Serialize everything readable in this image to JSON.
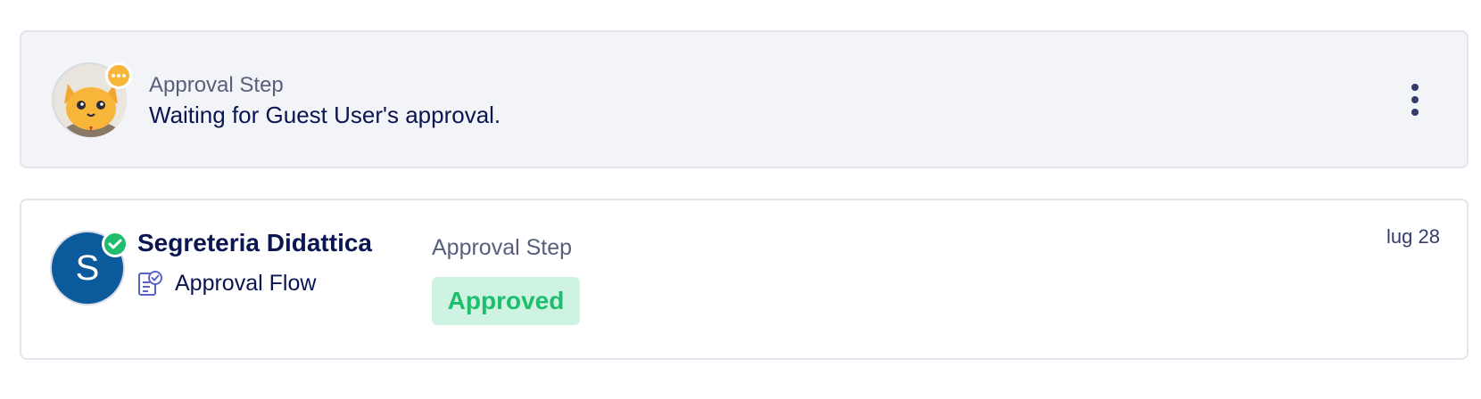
{
  "pending_step": {
    "step_label": "Approval Step",
    "message": "Waiting for Guest User's approval.",
    "avatar_icon": "cat-avatar-icon",
    "status_icon": "ellipsis-icon",
    "status_color": "#f7b53a",
    "menu_icon": "kebab-menu-icon"
  },
  "approved_step": {
    "avatar_initial": "S",
    "avatar_color": "#0a5a9c",
    "user_name": "Segreteria Didattica",
    "flow_icon": "approval-flow-icon",
    "flow_label": "Approval Flow",
    "step_label": "Approval Step",
    "status_label": "Approved",
    "status_color": "#1dbf6c",
    "date": "lug 28"
  }
}
